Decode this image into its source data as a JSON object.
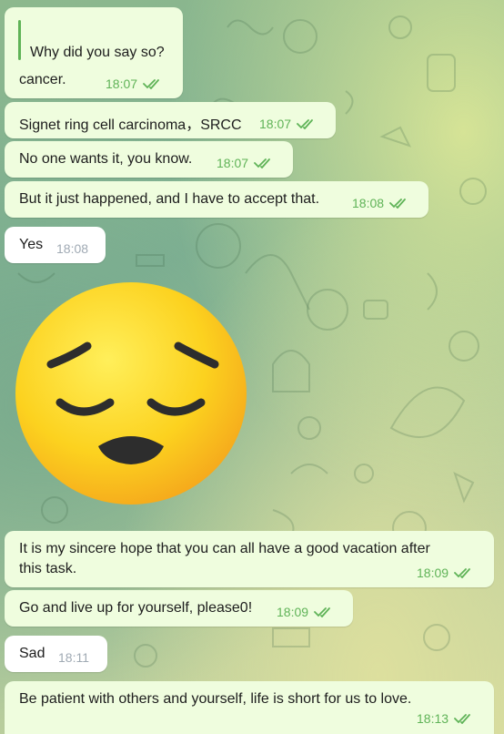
{
  "messages": [
    {
      "id": "m1",
      "reply_text": "Why did you say so?",
      "text": "cancer.",
      "time": "18:07",
      "direction": "outgoing",
      "status": "read"
    },
    {
      "id": "m2",
      "text": "Signet ring cell carcinoma，SRCC",
      "time": "18:07",
      "direction": "outgoing",
      "status": "read"
    },
    {
      "id": "m3",
      "text": "No one wants it, you know.",
      "time": "18:07",
      "direction": "outgoing",
      "status": "read"
    },
    {
      "id": "m4",
      "text": "But it just happened, and I have to accept that.",
      "time": "18:08",
      "direction": "outgoing",
      "status": "read"
    },
    {
      "id": "m5",
      "text": "Yes",
      "time": "18:08",
      "direction": "incoming"
    },
    {
      "id": "sticker",
      "type": "sticker",
      "icon": "pensive-face-emoji"
    },
    {
      "id": "m6",
      "text_line1": "It is my sincere hope that you can all have a good vacation after",
      "text_line2": "this task.",
      "time": "18:09",
      "direction": "outgoing",
      "status": "read"
    },
    {
      "id": "m7",
      "text": "Go and live up for yourself, please0!",
      "time": "18:09",
      "direction": "outgoing",
      "status": "read"
    },
    {
      "id": "m8",
      "text": "Sad",
      "time": "18:11",
      "direction": "incoming"
    },
    {
      "id": "m9",
      "text": "Be patient with others and yourself, life is short for us to love.",
      "time": "18:13",
      "direction": "outgoing",
      "status": "read"
    }
  ],
  "colors": {
    "outgoing_bubble": "#effdde",
    "incoming_bubble": "#ffffff",
    "read_check": "#5fb357",
    "incoming_time": "#a0aab4"
  }
}
